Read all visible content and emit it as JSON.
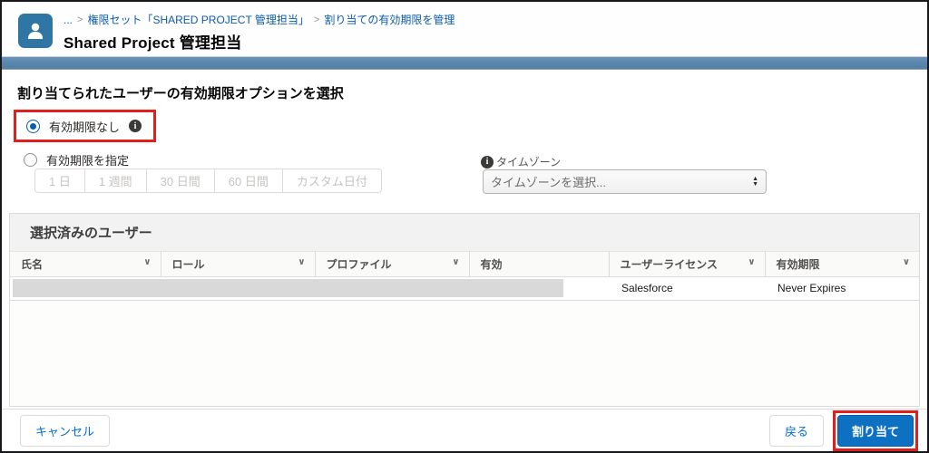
{
  "header": {
    "breadcrumb": {
      "items": [
        "...",
        "権限セット「SHARED PROJECT 管理担当」",
        "割り当ての有効期限を管理"
      ],
      "separator": ">"
    },
    "title": "Shared Project 管理担当"
  },
  "main": {
    "heading": "割り当てられたユーザーの有効期限オプションを選択",
    "options": [
      {
        "label": "有効期限なし",
        "selected": true,
        "annotated": true
      },
      {
        "label": "有効期限を指定",
        "selected": false
      }
    ],
    "duration_buttons": [
      "1 日",
      "1 週間",
      "30 日間",
      "60 日間",
      "カスタム日付"
    ],
    "timezone": {
      "label": "タイムゾーン",
      "placeholder": "タイムゾーンを選択..."
    }
  },
  "table": {
    "section_title": "選択済みのユーザー",
    "columns": [
      {
        "label": "氏名"
      },
      {
        "label": "ロール"
      },
      {
        "label": "プロファイル"
      },
      {
        "label": "有効"
      },
      {
        "label": "ユーザーライセンス"
      },
      {
        "label": "有効期限"
      }
    ],
    "row": {
      "license": "Salesforce",
      "expiration": "Never Expires",
      "redacted": true
    }
  },
  "footer": {
    "cancel_label": "キャンセル",
    "back_label": "戻る",
    "assign_label": "割り当て"
  },
  "icons": {
    "info": "i",
    "chevron_down": "∨",
    "stepper_up": "▲",
    "stepper_down": "▼"
  },
  "colors": {
    "brand_blue": "#0d70c0",
    "link_blue": "#0b5cab",
    "entity_icon_blue": "#2f76a4",
    "header_band_blue": "#5b87b0",
    "annotation_red": "#e0201c",
    "border_gray": "#dddbda",
    "section_bg": "#f3f2f2",
    "redaction_gray": "#d9d9d9"
  }
}
